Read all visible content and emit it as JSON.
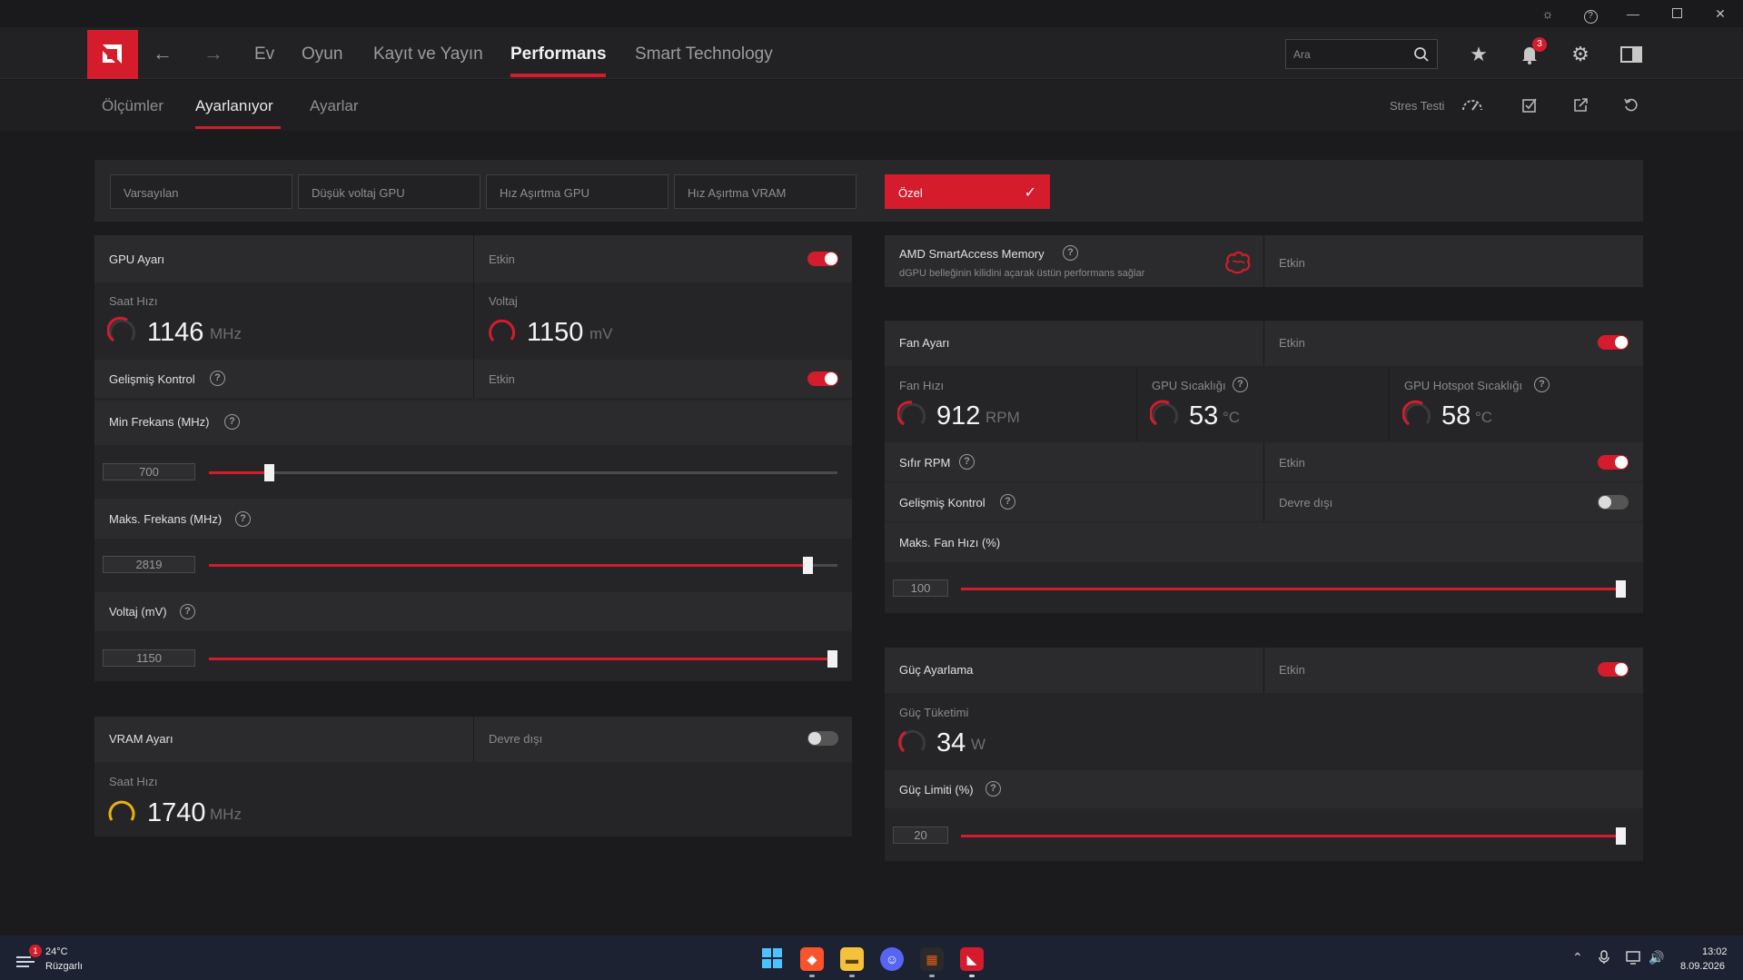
{
  "nav": {
    "home": "Ev",
    "gaming": "Oyun",
    "record": "Kayıt ve Yayın",
    "performance": "Performans",
    "smart": "Smart Technology"
  },
  "search": {
    "placeholder": "Ara"
  },
  "notifications": {
    "count": "3"
  },
  "subtabs": {
    "metrics": "Ölçümler",
    "tuning": "Ayarlanıyor",
    "settings": "Ayarlar"
  },
  "stress_test": "Stres Testi",
  "presets": [
    {
      "label": "Varsayılan"
    },
    {
      "label": "Düşük voltaj GPU"
    },
    {
      "label": "Hız Aşırtma GPU"
    },
    {
      "label": "Hız Aşırtma VRAM"
    },
    {
      "label": "Özel",
      "active": true
    }
  ],
  "gpu_tuning": {
    "title": "GPU Ayarı",
    "state": "Etkin",
    "enabled": true,
    "clock_label": "Saat Hızı",
    "clock_value": "1146",
    "clock_unit": "MHz",
    "voltage_label": "Voltaj",
    "voltage_value": "1150",
    "voltage_unit": "mV",
    "advanced_label": "Gelişmiş Kontrol",
    "advanced_state": "Etkin",
    "advanced_enabled": true,
    "min_freq_label": "Min Frekans (MHz)",
    "min_freq_value": "700",
    "min_freq_pct": 0.09,
    "max_freq_label": "Maks. Frekans (MHz)",
    "max_freq_value": "2819",
    "max_freq_pct": 0.96,
    "volt_slider_label": "Voltaj (mV)",
    "volt_slider_value": "1150",
    "volt_slider_pct": 1.0
  },
  "vram_tuning": {
    "title": "VRAM Ayarı",
    "state": "Devre dışı",
    "enabled": false,
    "clock_label": "Saat Hızı",
    "clock_value": "1740",
    "clock_unit": "MHz"
  },
  "sam": {
    "title": "AMD SmartAccess Memory",
    "desc": "dGPU belleğinin kilidini açarak üstün performans sağlar",
    "state": "Etkin"
  },
  "fan_tuning": {
    "title": "Fan Ayarı",
    "state": "Etkin",
    "enabled": true,
    "fan_speed_label": "Fan Hızı",
    "fan_speed_value": "912",
    "fan_speed_unit": "RPM",
    "gpu_temp_label": "GPU Sıcaklığı",
    "gpu_temp_value": "53",
    "gpu_temp_unit": "°C",
    "hotspot_label": "GPU Hotspot Sıcaklığı",
    "hotspot_value": "58",
    "hotspot_unit": "°C",
    "zero_rpm_label": "Sıfır RPM",
    "zero_rpm_state": "Etkin",
    "zero_rpm_enabled": true,
    "advanced_label": "Gelişmiş Kontrol",
    "advanced_state": "Devre dışı",
    "advanced_enabled": false,
    "max_fan_label": "Maks. Fan Hızı (%)",
    "max_fan_value": "100",
    "max_fan_pct": 1.0
  },
  "power_tuning": {
    "title": "Güç Ayarlama",
    "state": "Etkin",
    "enabled": true,
    "consumption_label": "Güç Tüketimi",
    "consumption_value": "34",
    "consumption_unit": "W",
    "limit_label": "Güç Limiti (%)",
    "limit_value": "20",
    "limit_pct": 1.0
  },
  "taskbar": {
    "weather_temp": "24°C",
    "weather_desc": "Rüzgarlı",
    "weather_badge": "1",
    "time": "13:02",
    "date": "8.09.2026"
  },
  "colors": {
    "accent": "#d41c2c",
    "gauge_vram": "#e8b20e"
  }
}
